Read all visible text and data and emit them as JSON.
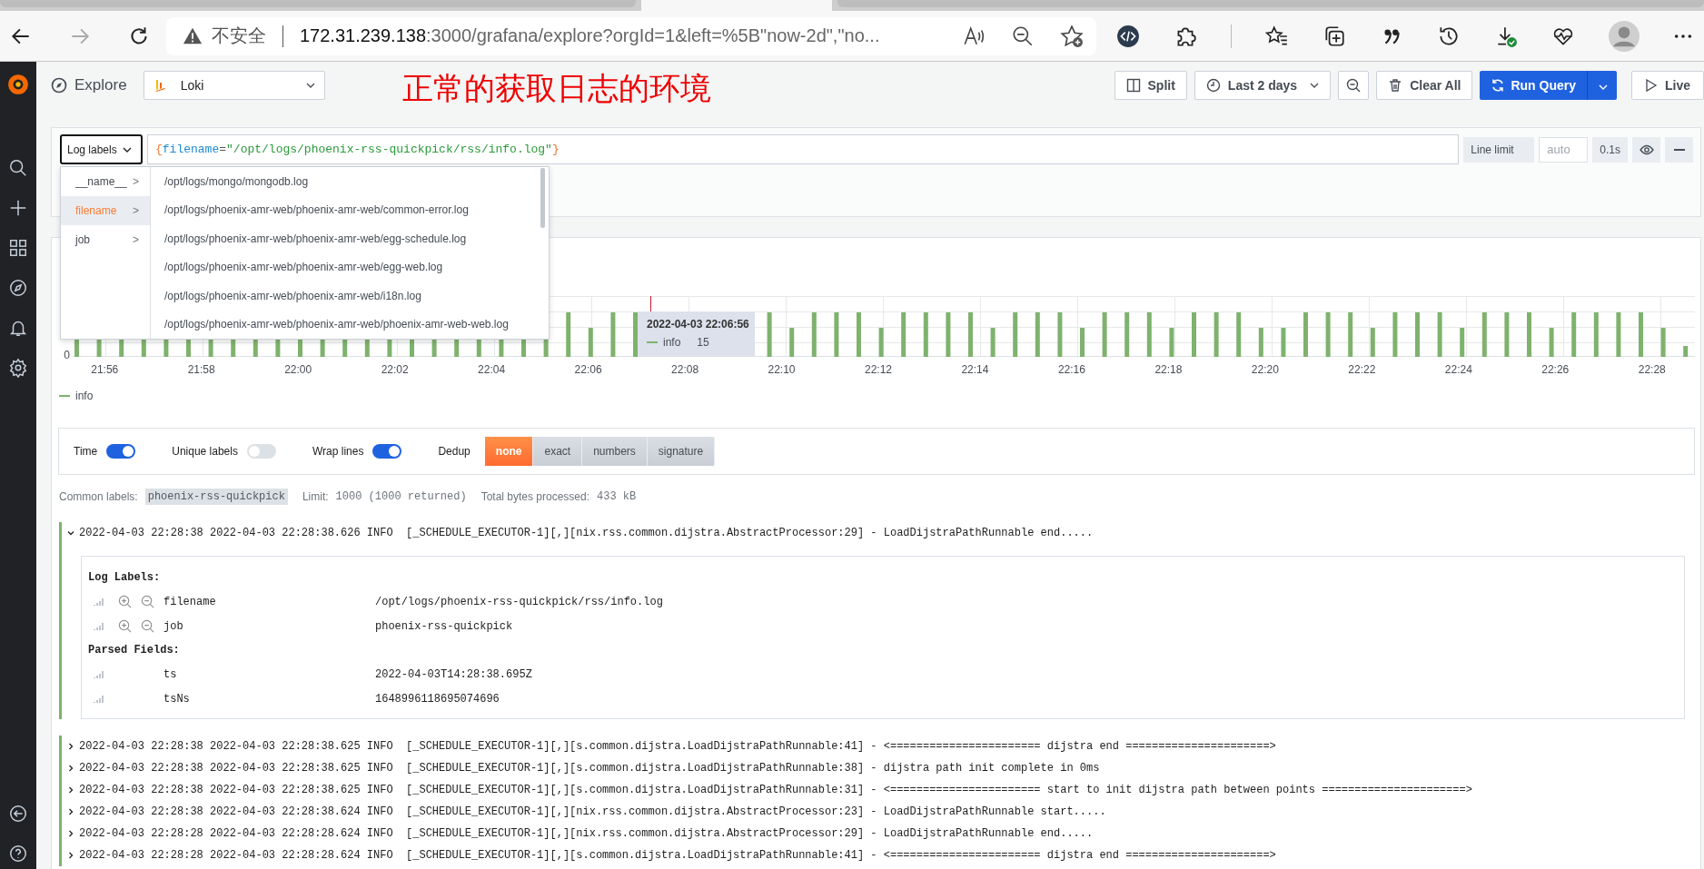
{
  "browser": {
    "tabs": [
      {
        "selected": false
      },
      {
        "selected": true
      },
      {
        "selected": false
      }
    ],
    "insecure_label": "不安全",
    "url_host": "172.31.239.138",
    "url_rest": ":3000/grafana/explore?orgId=1&left=%5B\"now-2d\",\"no..."
  },
  "header": {
    "title": "Explore",
    "datasource": "Loki",
    "annotation": "正常的获取日志的环境",
    "buttons": [
      {
        "kind": "split",
        "label": "Split"
      },
      {
        "kind": "time",
        "label": "Last 2 days"
      },
      {
        "kind": "zoom"
      },
      {
        "kind": "clear",
        "label": "Clear All"
      },
      {
        "kind": "run",
        "label": "Run Query"
      },
      {
        "kind": "live",
        "label": "Live"
      }
    ]
  },
  "query": {
    "labels_button": "Log labels",
    "expression": [
      {
        "kind": "brace",
        "text": "{"
      },
      {
        "kind": "key",
        "text": "filename"
      },
      {
        "kind": "op",
        "text": "="
      },
      {
        "kind": "string",
        "text": "\"/opt/logs/phoenix-rss-quickpick/rss/info.log\""
      },
      {
        "kind": "brace",
        "text": "}"
      }
    ],
    "line_limit_label": "Line limit",
    "line_limit_placeholder": "auto",
    "query_time": "0.1s"
  },
  "label_menu": {
    "labels": [
      {
        "name": "__name__",
        "arrow": ">",
        "selected": false
      },
      {
        "name": "filename",
        "arrow": ">",
        "selected": true
      },
      {
        "name": "job",
        "arrow": ">",
        "selected": false
      }
    ],
    "values": [
      "/opt/logs/mongo/mongodb.log",
      "/opt/logs/phoenix-amr-web/phoenix-amr-web/common-error.log",
      "/opt/logs/phoenix-amr-web/phoenix-amr-web/egg-schedule.log",
      "/opt/logs/phoenix-amr-web/phoenix-amr-web/egg-web.log",
      "/opt/logs/phoenix-amr-web/phoenix-amr-web/i18n.log",
      "/opt/logs/phoenix-amr-web/phoenix-amr-web/phoenix-amr-web-web.log"
    ]
  },
  "chart": {
    "y_tick": "0",
    "x_ticks": [
      "21:56",
      "21:58",
      "22:00",
      "22:02",
      "22:04",
      "22:06",
      "22:08",
      "22:10",
      "22:12",
      "22:14",
      "22:16",
      "22:18",
      "22:20",
      "22:22",
      "22:24",
      "22:26",
      "22:28"
    ],
    "legend": "info",
    "tooltip": {
      "time": "2022-04-03 22:06:56",
      "series": "info",
      "value": "15"
    }
  },
  "options": {
    "toggles": [
      {
        "label": "Time",
        "on": true
      },
      {
        "label": "Unique labels",
        "on": false
      },
      {
        "label": "Wrap lines",
        "on": true
      }
    ],
    "dedup_label": "Dedup",
    "dedup": [
      {
        "label": "none",
        "selected": true
      },
      {
        "label": "exact",
        "selected": false
      },
      {
        "label": "numbers",
        "selected": false
      },
      {
        "label": "signature",
        "selected": false
      }
    ]
  },
  "meta": [
    {
      "label": "Common labels:",
      "value": "phoenix-rss-quickpick",
      "kind": "tag"
    },
    {
      "label": "Limit:",
      "value": "1000 (1000 returned)",
      "kind": "plain"
    },
    {
      "label": "Total bytes processed:",
      "value": "433 kB",
      "kind": "plain"
    }
  ],
  "logs": [
    {
      "text": "2022-04-03 22:28:38 2022-04-03 22:28:38.626 INFO  [_SCHEDULE_EXECUTOR-1][,][nix.rss.common.dijstra.AbstractProcessor:29] - LoadDijstraPathRunnable end.....",
      "expanded": true,
      "details": [
        {
          "title": "Log Labels:",
          "fields": [
            {
              "name": "filename",
              "value": "/opt/logs/phoenix-rss-quickpick/rss/info.log",
              "filterable": true
            },
            {
              "name": "job",
              "value": "phoenix-rss-quickpick",
              "filterable": true
            }
          ]
        },
        {
          "title": "Parsed Fields:",
          "fields": [
            {
              "name": "ts",
              "value": "2022-04-03T14:28:38.695Z",
              "filterable": false
            },
            {
              "name": "tsNs",
              "value": "1648996118695074696",
              "filterable": false
            }
          ]
        }
      ]
    },
    {
      "text": "2022-04-03 22:28:38 2022-04-03 22:28:38.625 INFO  [_SCHEDULE_EXECUTOR-1][,][s.common.dijstra.LoadDijstraPathRunnable:41] - <======================= dijstra end ======================>",
      "expanded": false
    },
    {
      "text": "2022-04-03 22:28:38 2022-04-03 22:28:38.625 INFO  [_SCHEDULE_EXECUTOR-1][,][s.common.dijstra.LoadDijstraPathRunnable:38] - dijstra path init complete in 0ms",
      "expanded": false
    },
    {
      "text": "2022-04-03 22:28:38 2022-04-03 22:28:38.625 INFO  [_SCHEDULE_EXECUTOR-1][,][s.common.dijstra.LoadDijstraPathRunnable:31] - <======================= start to init dijstra path between points ======================>",
      "expanded": false
    },
    {
      "text": "2022-04-03 22:28:38 2022-04-03 22:28:38.624 INFO  [_SCHEDULE_EXECUTOR-1][,][nix.rss.common.dijstra.AbstractProcessor:23] - LoadDijstraPathRunnable start.....",
      "expanded": false
    },
    {
      "text": "2022-04-03 22:28:28 2022-04-03 22:28:28.624 INFO  [_SCHEDULE_EXECUTOR-1][,][nix.rss.common.dijstra.AbstractProcessor:29] - LoadDijstraPathRunnable end.....",
      "expanded": false
    },
    {
      "text": "2022-04-03 22:28:28 2022-04-03 22:28:28.624 INFO  [_SCHEDULE_EXECUTOR-1][,][s.common.dijstra.LoadDijstraPathRunnable:41] - <======================= dijstra end ======================>",
      "expanded": false
    }
  ]
}
